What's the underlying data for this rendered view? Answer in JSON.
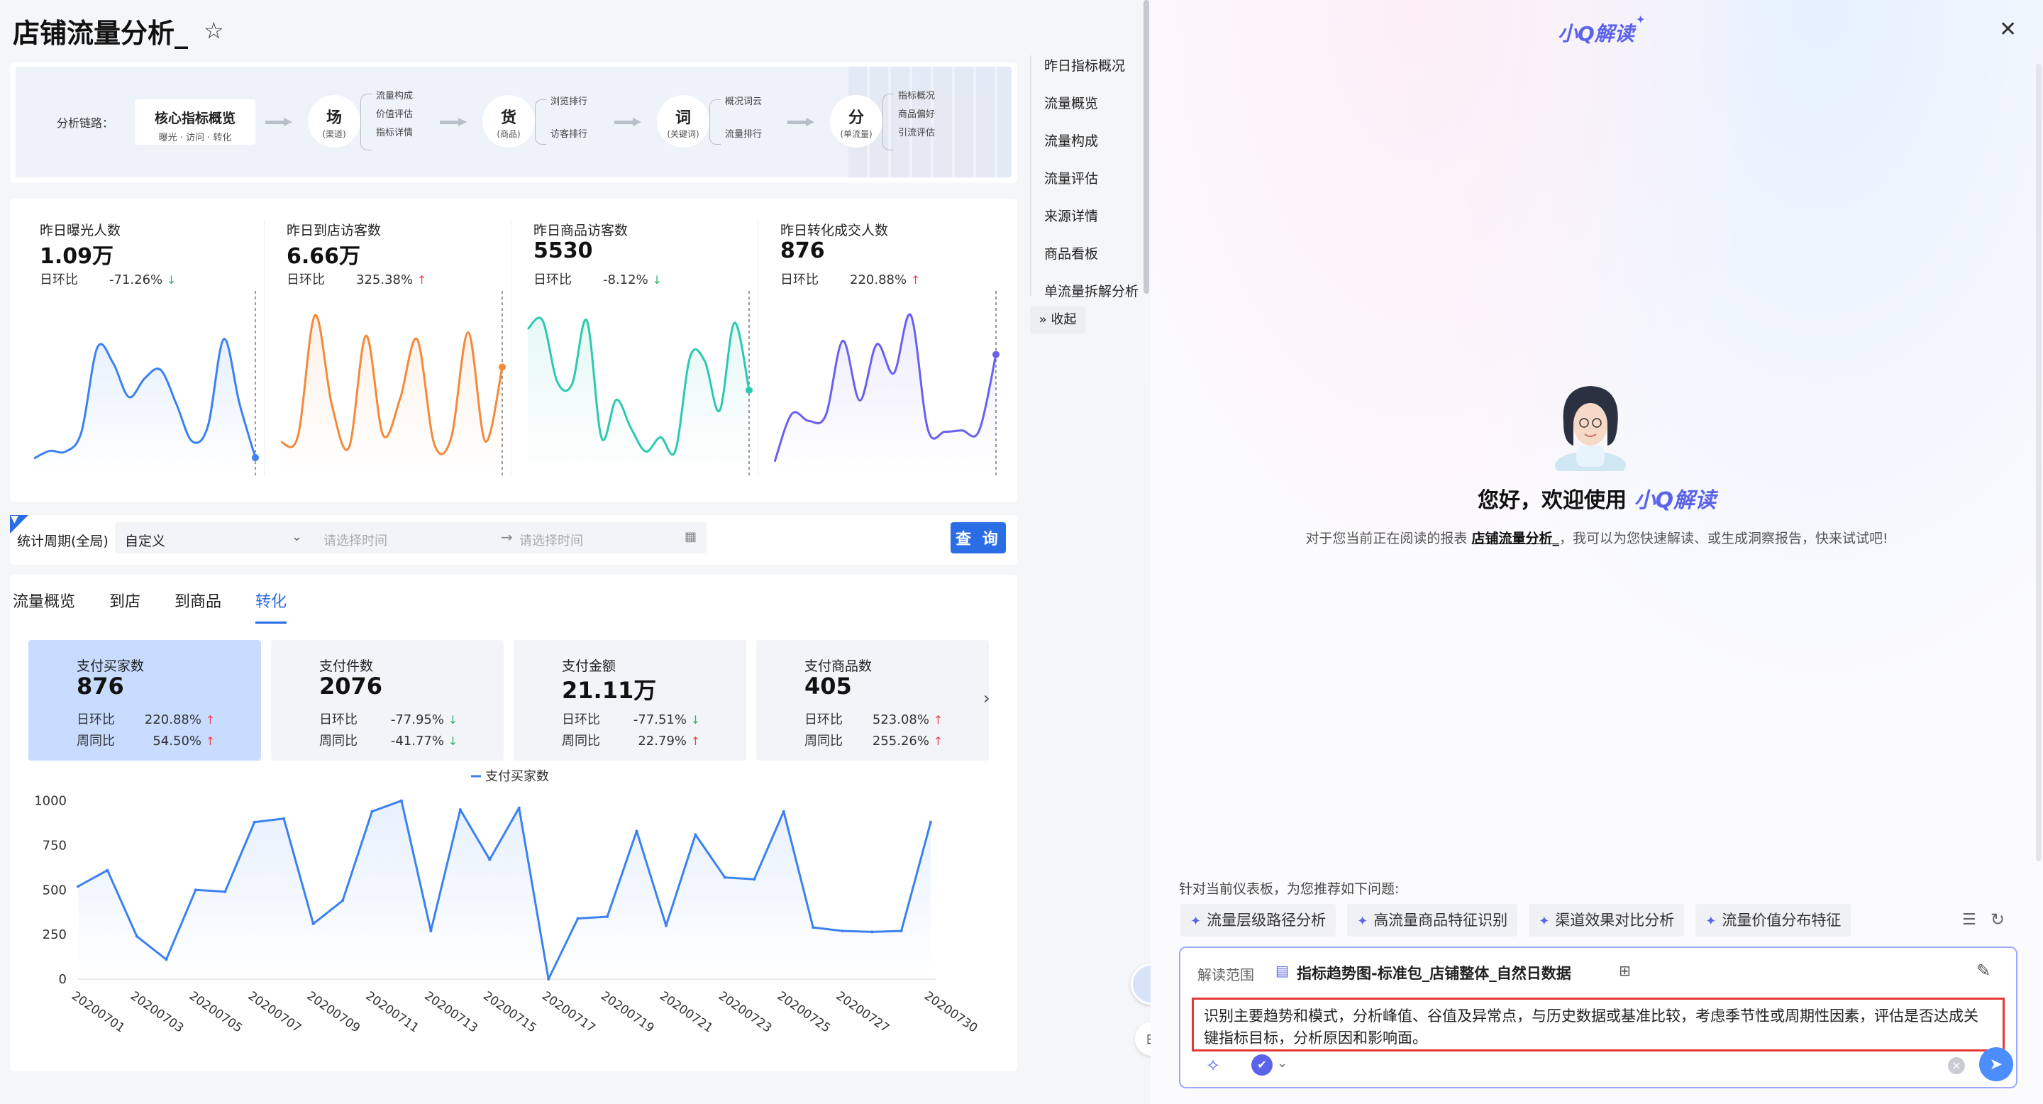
{
  "header": {
    "title": "店铺流量分析_"
  },
  "chain": {
    "label": "分析链路：",
    "core": {
      "title": "核心指标概览",
      "sub": "曝光 · 访问 · 转化"
    },
    "nodes": [
      {
        "main": "场",
        "sub": "(渠道)",
        "branches": [
          "流量构成",
          "价值评估",
          "指标详情"
        ]
      },
      {
        "main": "货",
        "sub": "(商品)",
        "branches": [
          "浏览排行",
          "访客排行"
        ]
      },
      {
        "main": "词",
        "sub": "(关键词)",
        "branches": [
          "概况词云",
          "流量排行"
        ]
      },
      {
        "main": "分",
        "sub": "(单流量)",
        "branches": [
          "指标概况",
          "商品偏好",
          "引流评估"
        ]
      }
    ]
  },
  "kpis": [
    {
      "label": "昨日曝光人数",
      "value": "1.09万",
      "cmp_label": "日环比",
      "cmp_value": "-71.26%",
      "dir": "down",
      "color": "#3b82f0",
      "series": [
        50,
        72,
        70,
        128,
        375,
        330,
        230,
        285,
        310,
        210,
        100,
        145,
        400,
        210,
        52
      ]
    },
    {
      "label": "昨日到店访客数",
      "value": "6.66万",
      "cmp_label": "日环比",
      "cmp_value": "325.38%",
      "dir": "up",
      "color": "#f5893a",
      "series": [
        98,
        115,
        470,
        205,
        82,
        410,
        118,
        225,
        400,
        93,
        110,
        420,
        100,
        318
      ]
    },
    {
      "label": "昨日商品访客数",
      "value": "5530",
      "cmp_label": "日环比",
      "cmp_value": "-8.12%",
      "dir": "down",
      "color": "#2cc9b0",
      "series": [
        430,
        455,
        275,
        268,
        455,
        110,
        222,
        138,
        70,
        112,
        72,
        348,
        335,
        190,
        448,
        250
      ]
    },
    {
      "label": "昨日转化成交人数",
      "value": "876",
      "cmp_label": "日环比",
      "cmp_value": "220.88%",
      "dir": "up",
      "color": "#6b5ff0",
      "series": [
        40,
        180,
        160,
        176,
        395,
        220,
        385,
        300,
        470,
        135,
        128,
        132,
        130,
        355
      ]
    }
  ],
  "filter": {
    "label": "统计周期(全局)",
    "period": "自定义",
    "start_placeholder": "请选择时间",
    "end_placeholder": "请选择时间",
    "query_label": "查 询"
  },
  "tabs": [
    "流量概览",
    "到店",
    "到商品",
    "转化"
  ],
  "active_tab": 3,
  "metrics": [
    {
      "label": "支付买家数",
      "value": "876",
      "day_label": "日环比",
      "day_value": "220.88%",
      "day_dir": "up",
      "week_label": "周同比",
      "week_value": "54.50%",
      "week_dir": "up",
      "selected": true
    },
    {
      "label": "支付件数",
      "value": "2076",
      "day_label": "日环比",
      "day_value": "-77.95%",
      "day_dir": "down",
      "week_label": "周同比",
      "week_value": "-41.77%",
      "week_dir": "down"
    },
    {
      "label": "支付金额",
      "value": "21.11万",
      "day_label": "日环比",
      "day_value": "-77.51%",
      "day_dir": "down",
      "week_label": "周同比",
      "week_value": "22.79%",
      "week_dir": "up"
    },
    {
      "label": "支付商品数",
      "value": "405",
      "day_label": "日环比",
      "day_value": "523.08%",
      "day_dir": "up",
      "week_label": "周同比",
      "week_value": "255.26%",
      "week_dir": "up"
    }
  ],
  "chart_data": {
    "type": "line",
    "title": "",
    "legend": "支付买家数",
    "legend_position": "top-center",
    "x": [
      "20200701",
      "20200702",
      "20200703",
      "20200704",
      "20200705",
      "20200706",
      "20200707",
      "20200708",
      "20200709",
      "20200710",
      "20200711",
      "20200712",
      "20200713",
      "20200714",
      "20200715",
      "20200716",
      "20200717",
      "20200718",
      "20200719",
      "20200720",
      "20200721",
      "20200722",
      "20200723",
      "20200724",
      "20200725",
      "20200726",
      "20200727",
      "20200728",
      "20200729",
      "20200730"
    ],
    "xticks": [
      "20200701",
      "20200703",
      "20200705",
      "20200707",
      "20200709",
      "20200711",
      "20200713",
      "20200715",
      "20200717",
      "20200719",
      "20200721",
      "20200723",
      "20200725",
      "20200727",
      "20200730"
    ],
    "series": [
      {
        "name": "支付买家数",
        "color": "#3b82f0",
        "values": [
          520,
          610,
          240,
          110,
          500,
          490,
          880,
          900,
          310,
          440,
          940,
          1000,
          270,
          950,
          670,
          960,
          0,
          340,
          350,
          830,
          300,
          810,
          570,
          560,
          940,
          290,
          270,
          265,
          270,
          880
        ]
      }
    ],
    "yticks": [
      0,
      250,
      500,
      750,
      1000
    ],
    "ylim": [
      0,
      1050
    ],
    "grid": false
  },
  "outline": [
    "昨日指标概况",
    "流量概览",
    "流量构成",
    "流量评估",
    "来源详情",
    "商品看板",
    "单流量拆解分析"
  ],
  "outline_collapse": "收起",
  "assistant": {
    "title": "小Q解读",
    "welcome_prefix": "您好，欢迎使用",
    "welcome_brand": "小Q解读",
    "intro_prefix": "对于您当前正在阅读的报表",
    "intro_link": "店铺流量分析_",
    "intro_suffix": "，我可以为您快速解读、或生成洞察报告，快来试试吧!",
    "suggest_head": "针对当前仪表板，为您推荐如下问题:",
    "chips": [
      "流量层级路径分析",
      "高流量商品特征识别",
      "渠道效果对比分析",
      "流量价值分布特征"
    ],
    "scope_label": "解读范围",
    "scope_value": "指标趋势图-标准包_店铺整体_自然日数据",
    "prompt": "识别主要趋势和模式，分析峰值、谷值及异常点，与历史数据或基准比较，考虑季节性或周期性因素，评估是否达成关键指标目标，分析原因和影响面。"
  }
}
